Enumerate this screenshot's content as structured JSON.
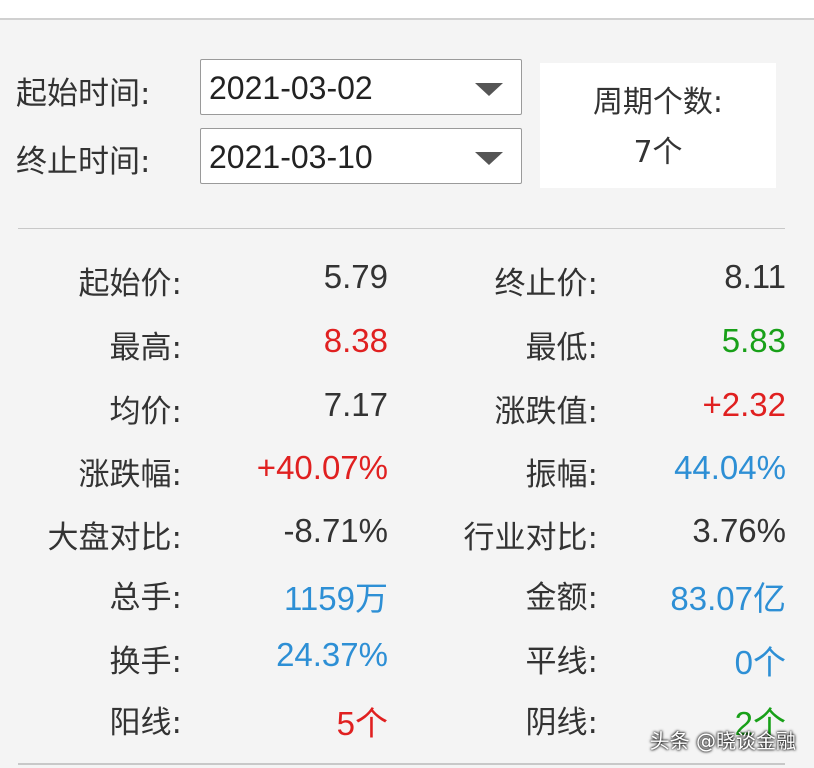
{
  "filter": {
    "start_label": "起始时间:",
    "start_value": "2021-03-02",
    "end_label": "终止时间:",
    "end_value": "2021-03-10",
    "period_label": "周期个数:",
    "period_value": "7个"
  },
  "colors": {
    "default": "#333333",
    "red": "#e02020",
    "green": "#18a018",
    "blue": "#2d8fd5"
  },
  "stats": [
    {
      "k1": "起始价:",
      "v1": "5.79",
      "c1": "default",
      "k2": "终止价:",
      "v2": "8.11",
      "c2": "default"
    },
    {
      "k1": "最高:",
      "v1": "8.38",
      "c1": "red",
      "k2": "最低:",
      "v2": "5.83",
      "c2": "green"
    },
    {
      "k1": "均价:",
      "v1": "7.17",
      "c1": "default",
      "k2": "涨跌值:",
      "v2": "+2.32",
      "c2": "red"
    },
    {
      "k1": "涨跌幅:",
      "v1": "+40.07%",
      "c1": "red",
      "k2": "振幅:",
      "v2": "44.04%",
      "c2": "blue"
    },
    {
      "k1": "大盘对比:",
      "v1": "-8.71%",
      "c1": "default",
      "k2": "行业对比:",
      "v2": "3.76%",
      "c2": "default"
    },
    {
      "k1": "总手:",
      "v1": "1159万",
      "c1": "blue",
      "k2": "金额:",
      "v2": "83.07亿",
      "c2": "blue"
    },
    {
      "k1": "换手:",
      "v1": "24.37%",
      "c1": "blue",
      "k2": "平线:",
      "v2": "0个",
      "c2": "blue"
    },
    {
      "k1": "阳线:",
      "v1": "5个",
      "c1": "red",
      "k2": "阴线:",
      "v2": "2个",
      "c2": "green"
    }
  ],
  "watermark": "头条 @晓谈金融"
}
